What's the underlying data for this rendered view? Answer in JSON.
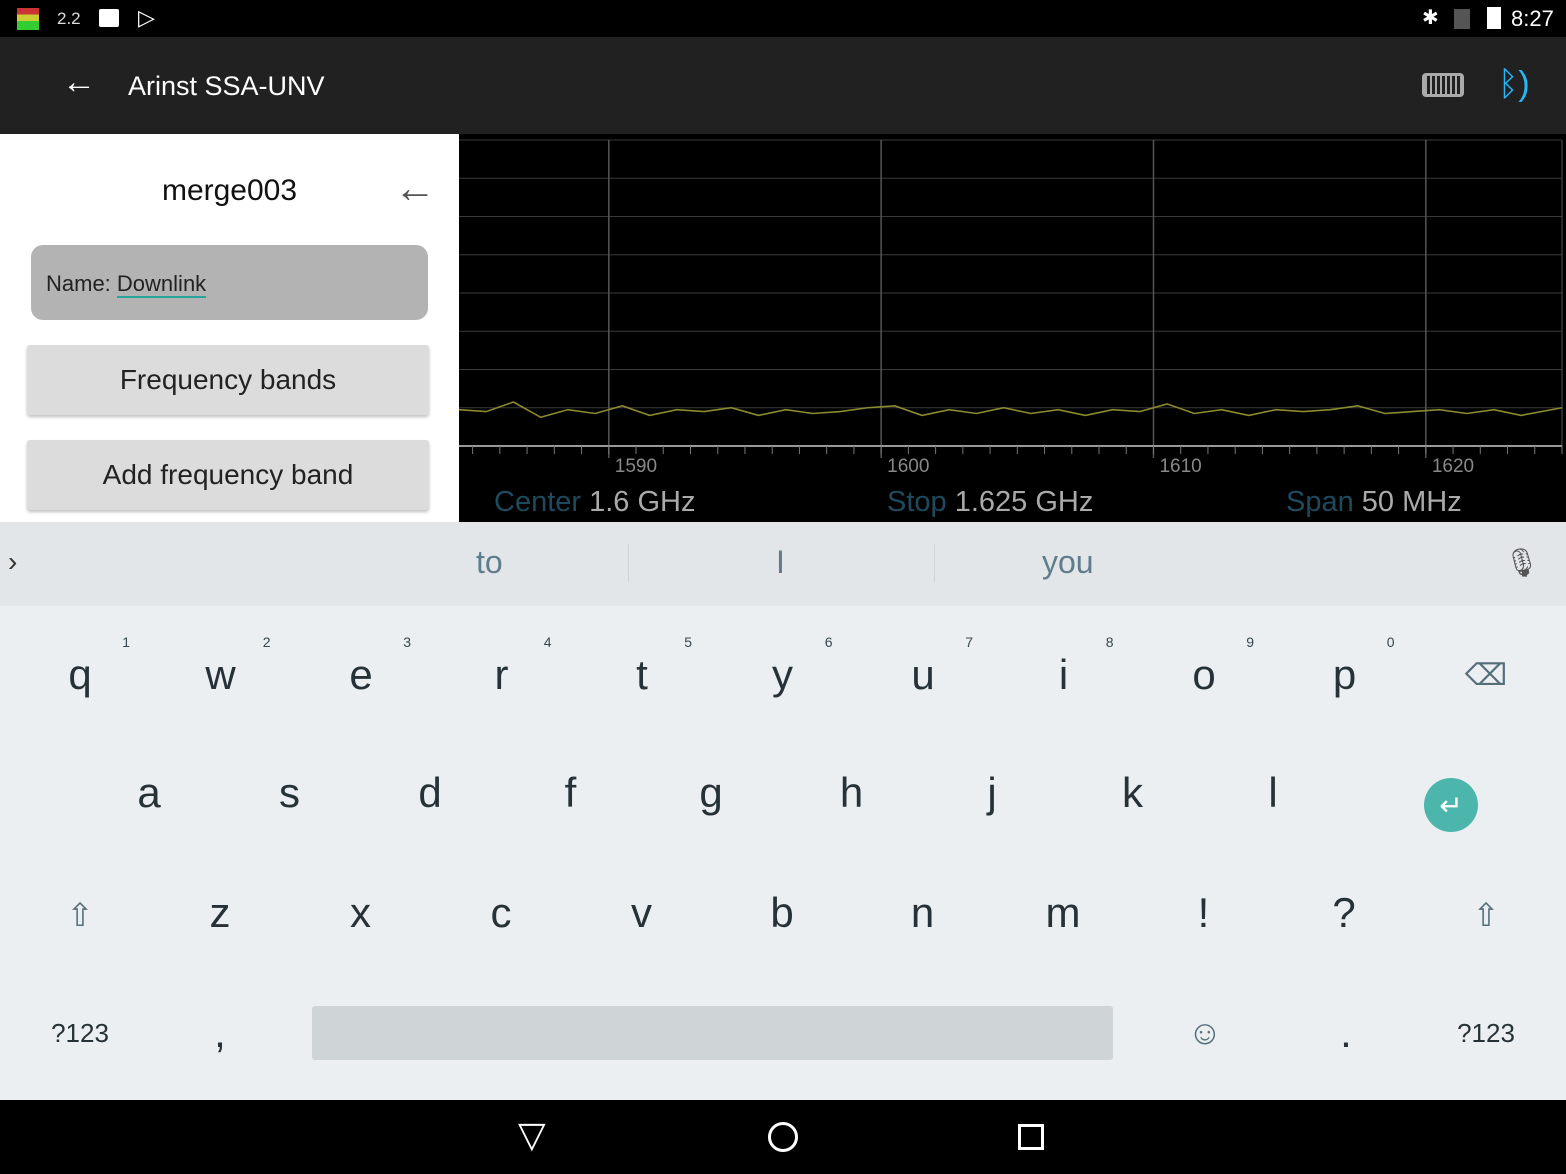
{
  "status_bar": {
    "indicator_text": "2.2",
    "time": "8:27",
    "icons": [
      "equalizer-icon",
      "image-icon",
      "play-store-icon",
      "bluetooth-icon",
      "no-sim-icon",
      "battery-charging-icon"
    ]
  },
  "app_bar": {
    "title": "Arinst SSA-UNV",
    "icons": [
      "back-arrow-icon",
      "device-battery-icon",
      "bluetooth-connected-icon"
    ],
    "bluetooth_color": "#29b6f6"
  },
  "panel": {
    "title": "merge003",
    "name_label": "Name: ",
    "name_value": "Downlink",
    "frequency_bands": "Frequency bands",
    "add_frequency_band": "Add frequency band"
  },
  "chart_data": {
    "type": "line",
    "x_unit": "MHz",
    "xlim": [
      1584.5,
      1625
    ],
    "ylim": [
      0,
      8
    ],
    "grid": true,
    "x_ticks": [
      "1590",
      "1600",
      "1610",
      "1620"
    ],
    "x_tick_values": [
      1590,
      1600,
      1610,
      1620
    ],
    "trace_color": "#8c8a2e",
    "x": [
      1584.5,
      1585.5,
      1586.5,
      1587.5,
      1588.5,
      1589.5,
      1590.5,
      1591.5,
      1592.5,
      1593.5,
      1594.5,
      1595.5,
      1596.5,
      1597.5,
      1598.5,
      1599.5,
      1600.5,
      1601.5,
      1602.5,
      1603.5,
      1604.5,
      1605.5,
      1606.5,
      1607.5,
      1608.5,
      1609.5,
      1610.5,
      1611.5,
      1612.5,
      1613.5,
      1614.5,
      1615.5,
      1616.5,
      1617.5,
      1618.5,
      1619.5,
      1620.5,
      1621.5,
      1622.5,
      1623.5,
      1625
    ],
    "y": [
      0.95,
      0.9,
      1.15,
      0.75,
      0.95,
      0.85,
      1.05,
      0.8,
      0.95,
      0.9,
      1.0,
      0.8,
      0.95,
      0.85,
      0.9,
      1.0,
      1.05,
      0.8,
      0.95,
      0.85,
      1.0,
      0.85,
      0.95,
      0.8,
      0.95,
      0.9,
      1.1,
      0.85,
      0.95,
      0.8,
      0.95,
      0.9,
      0.95,
      1.05,
      0.85,
      0.9,
      0.95,
      0.85,
      0.95,
      0.8,
      1.0
    ],
    "readouts": [
      {
        "label": "Center",
        "value": "1.6 GHz"
      },
      {
        "label": "Stop",
        "value": "1.625 GHz"
      },
      {
        "label": "Span",
        "value": "50 MHz"
      }
    ],
    "readout_label_color": "#1e4a5e"
  },
  "keyboard": {
    "suggestions": [
      "to",
      "I",
      "you"
    ],
    "row1": [
      {
        "k": "q",
        "h": "1"
      },
      {
        "k": "w",
        "h": "2"
      },
      {
        "k": "e",
        "h": "3"
      },
      {
        "k": "r",
        "h": "4"
      },
      {
        "k": "t",
        "h": "5"
      },
      {
        "k": "y",
        "h": "6"
      },
      {
        "k": "u",
        "h": "7"
      },
      {
        "k": "i",
        "h": "8"
      },
      {
        "k": "o",
        "h": "9"
      },
      {
        "k": "p",
        "h": "0"
      }
    ],
    "row2": [
      "a",
      "s",
      "d",
      "f",
      "g",
      "h",
      "j",
      "k",
      "l"
    ],
    "row3": [
      "z",
      "x",
      "c",
      "v",
      "b",
      "n",
      "m",
      "!",
      "?"
    ],
    "symbols": "?123",
    "comma": ",",
    "period": ".",
    "enter_color": "#4db6ac"
  }
}
